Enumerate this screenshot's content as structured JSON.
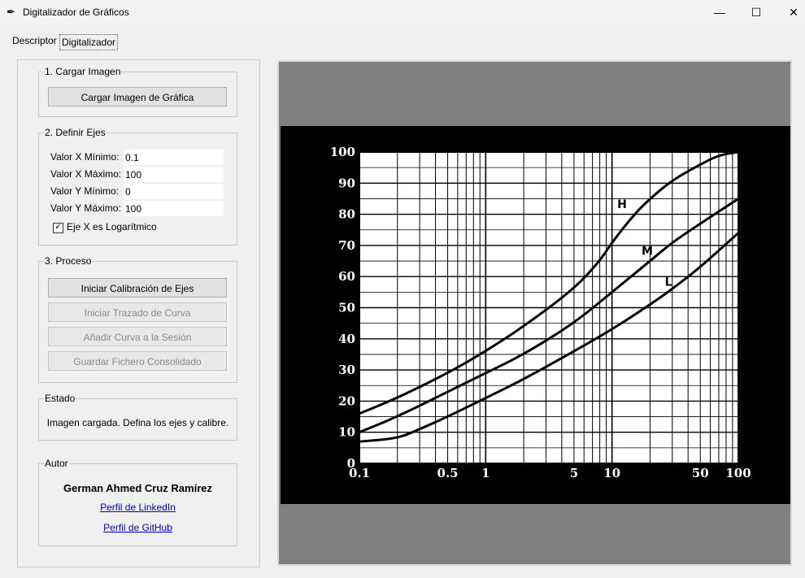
{
  "window": {
    "title": "Digitalizador de Gráficos",
    "minimize": "—",
    "maximize": "☐",
    "close": "✕",
    "icon": "feather-icon"
  },
  "tabs": [
    {
      "label": "Descriptor"
    },
    {
      "label": "Digitalizador"
    }
  ],
  "load": {
    "group_title": "1. Cargar Imagen",
    "button_label": "Cargar Imagen de Gráfica"
  },
  "axes": {
    "group_title": "2. Definir Ejes",
    "x_min_label": "Valor X Mínimo:",
    "x_min_value": "0.1",
    "x_max_label": "Valor X Máximo:",
    "x_max_value": "100",
    "y_min_label": "Valor Y Mínimo:",
    "y_min_value": "0",
    "y_max_label": "Valor Y Máximo:",
    "y_max_value": "100",
    "log_checkbox_label": "Eje X es Logarítmico",
    "log_checked": true
  },
  "process": {
    "group_title": "3. Proceso",
    "calibrate_label": "Iniciar Calibración de Ejes",
    "trace_label": "Iniciar Trazado de Curva",
    "add_curve_label": "Añadir Curva a la Sesión",
    "save_label": "Guardar Fichero Consolidado"
  },
  "status": {
    "group_title": "Estado",
    "text": "Imagen cargada. Defina los ejes y calibre."
  },
  "author": {
    "group_title": "Autor",
    "name": "German Ahmed Cruz Ramírez",
    "linkedin_label": "Perfil de LinkedIn",
    "github_label": "Perfil de GitHub"
  },
  "chart_data": {
    "type": "line",
    "x_scale": "log",
    "xlim": [
      0.1,
      100
    ],
    "ylim": [
      0,
      100
    ],
    "x_tick_labels": [
      "0.1",
      "0.5",
      "1",
      "5",
      "10",
      "50",
      "100"
    ],
    "x_tick_values": [
      0.1,
      0.5,
      1,
      5,
      10,
      50,
      100
    ],
    "y_tick_labels": [
      "0",
      "10",
      "20",
      "30",
      "40",
      "50",
      "60",
      "70",
      "80",
      "90",
      "100"
    ],
    "grid": true,
    "series": [
      {
        "name": "H",
        "x": [
          0.1,
          0.2,
          0.5,
          1,
          2,
          5,
          8,
          10,
          15,
          20,
          30,
          50,
          70,
          100
        ],
        "y": [
          16,
          21,
          29,
          36,
          44,
          56,
          65,
          71,
          80,
          85,
          91,
          96,
          99,
          100
        ]
      },
      {
        "name": "M",
        "x": [
          0.1,
          0.2,
          0.5,
          1,
          2,
          5,
          10,
          20,
          30,
          50,
          100
        ],
        "y": [
          10,
          15,
          23,
          29,
          35,
          45,
          55,
          65,
          71,
          77,
          85
        ]
      },
      {
        "name": "L",
        "x": [
          0.1,
          0.2,
          0.3,
          0.5,
          1,
          2,
          5,
          10,
          20,
          30,
          50,
          100
        ],
        "y": [
          7,
          8,
          11,
          15,
          21,
          27,
          36,
          43,
          51,
          56,
          63,
          74
        ]
      }
    ],
    "annotations": [
      "H",
      "M",
      "L"
    ]
  }
}
